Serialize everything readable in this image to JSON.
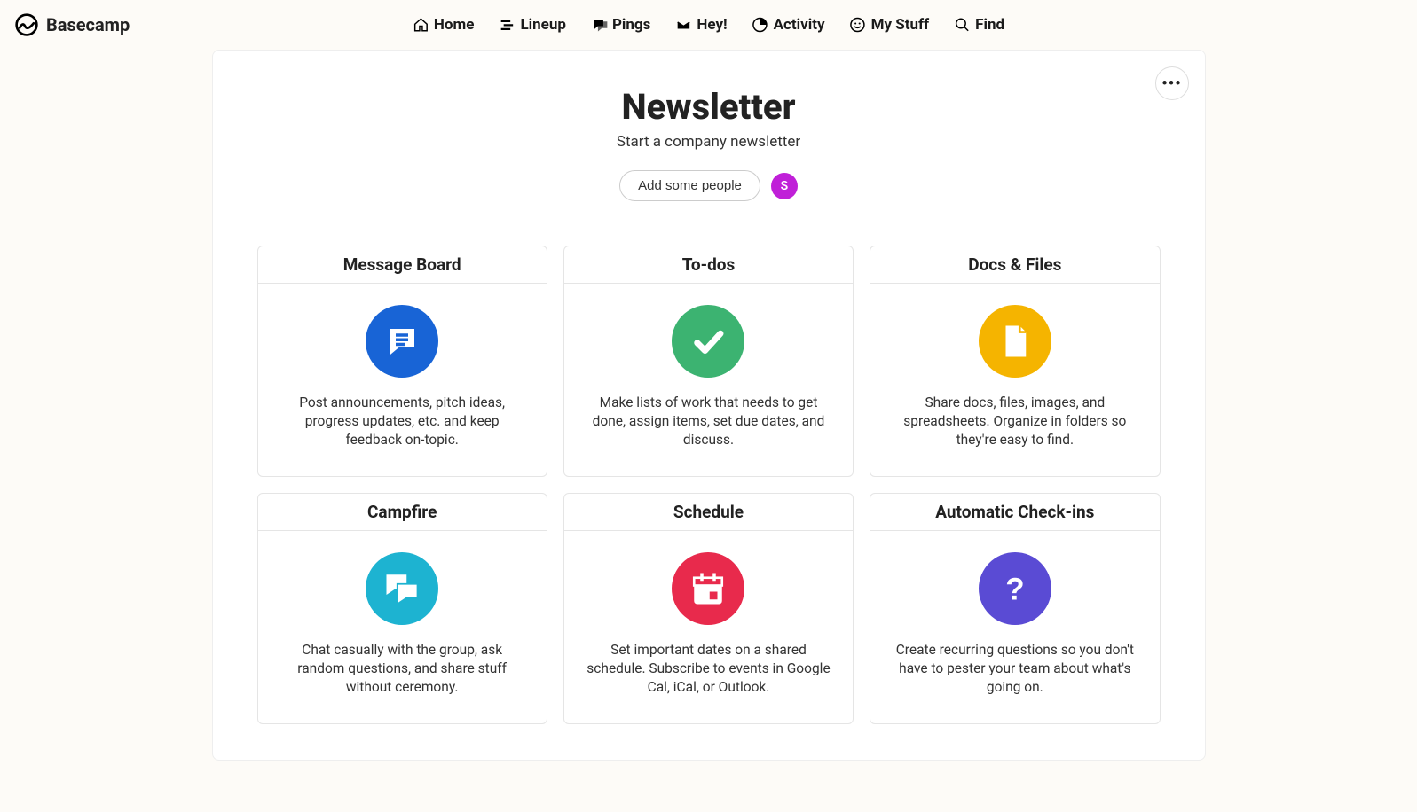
{
  "brand": "Basecamp",
  "nav": [
    {
      "label": "Home"
    },
    {
      "label": "Lineup"
    },
    {
      "label": "Pings"
    },
    {
      "label": "Hey!"
    },
    {
      "label": "Activity"
    },
    {
      "label": "My Stuff"
    },
    {
      "label": "Find"
    }
  ],
  "project": {
    "title": "Newsletter",
    "subtitle": "Start a company newsletter",
    "add_people_label": "Add some people",
    "avatar_initial": "S"
  },
  "tools": [
    {
      "title": "Message Board",
      "desc": "Post announcements, pitch ideas, progress updates, etc. and keep feedback on-topic.",
      "color": "c-blue",
      "icon": "message"
    },
    {
      "title": "To-dos",
      "desc": "Make lists of work that needs to get done, assign items, set due dates, and discuss.",
      "color": "c-green",
      "icon": "check"
    },
    {
      "title": "Docs & Files",
      "desc": "Share docs, files, images, and spreadsheets. Organize in folders so they're easy to find.",
      "color": "c-yellow",
      "icon": "doc"
    },
    {
      "title": "Campfire",
      "desc": "Chat casually with the group, ask random questions, and share stuff without ceremony.",
      "color": "c-teal",
      "icon": "chat"
    },
    {
      "title": "Schedule",
      "desc": "Set important dates on a shared schedule. Subscribe to events in Google Cal, iCal, or Outlook.",
      "color": "c-red",
      "icon": "calendar"
    },
    {
      "title": "Automatic Check-ins",
      "desc": "Create recurring questions so you don't have to pester your team about what's going on.",
      "color": "c-purple",
      "icon": "question"
    }
  ]
}
